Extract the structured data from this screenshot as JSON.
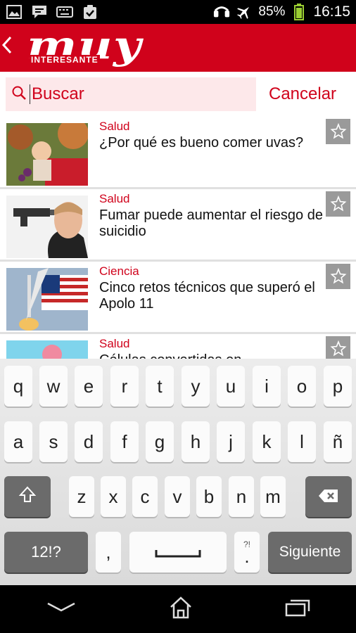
{
  "status_bar": {
    "battery": "85%",
    "time": "16:15",
    "left_icons": [
      "image-icon",
      "chat-icon",
      "keyboard-icon",
      "clipboard-check-icon"
    ],
    "right_icons": [
      "headset-icon",
      "airplane-icon",
      "battery-icon"
    ]
  },
  "header": {
    "brand": "muy",
    "brand_sub": "INTERESANTE",
    "back_icon": "chevron-left-icon",
    "color": "#d0021b"
  },
  "search": {
    "placeholder": "Buscar",
    "value": "",
    "cancel_label": "Cancelar"
  },
  "articles": [
    {
      "category": "Salud",
      "title": "¿Por qué es bueno comer uvas?",
      "thumb": "child-with-grapes"
    },
    {
      "category": "Salud",
      "title": "Fumar puede aumentar el riesgo de suicidio",
      "thumb": "man-with-gun"
    },
    {
      "category": "Ciencia",
      "title": "Cinco retos técnicos que superó el Apolo 11",
      "thumb": "rocket-flag"
    },
    {
      "category": "Salud",
      "title": "Células convertidas en",
      "thumb": "cells"
    }
  ],
  "keyboard": {
    "row1": [
      "q",
      "w",
      "e",
      "r",
      "t",
      "y",
      "u",
      "i",
      "o",
      "p"
    ],
    "row2": [
      "a",
      "s",
      "d",
      "f",
      "g",
      "h",
      "j",
      "k",
      "l",
      "ñ"
    ],
    "row3": [
      "z",
      "x",
      "c",
      "v",
      "b",
      "n",
      "m"
    ],
    "symbols_label": "12!?",
    "comma": ",",
    "period": ".",
    "period_hint": "?!",
    "action_label": "Siguiente"
  },
  "nav": [
    "back-icon",
    "home-icon",
    "recent-apps-icon"
  ]
}
